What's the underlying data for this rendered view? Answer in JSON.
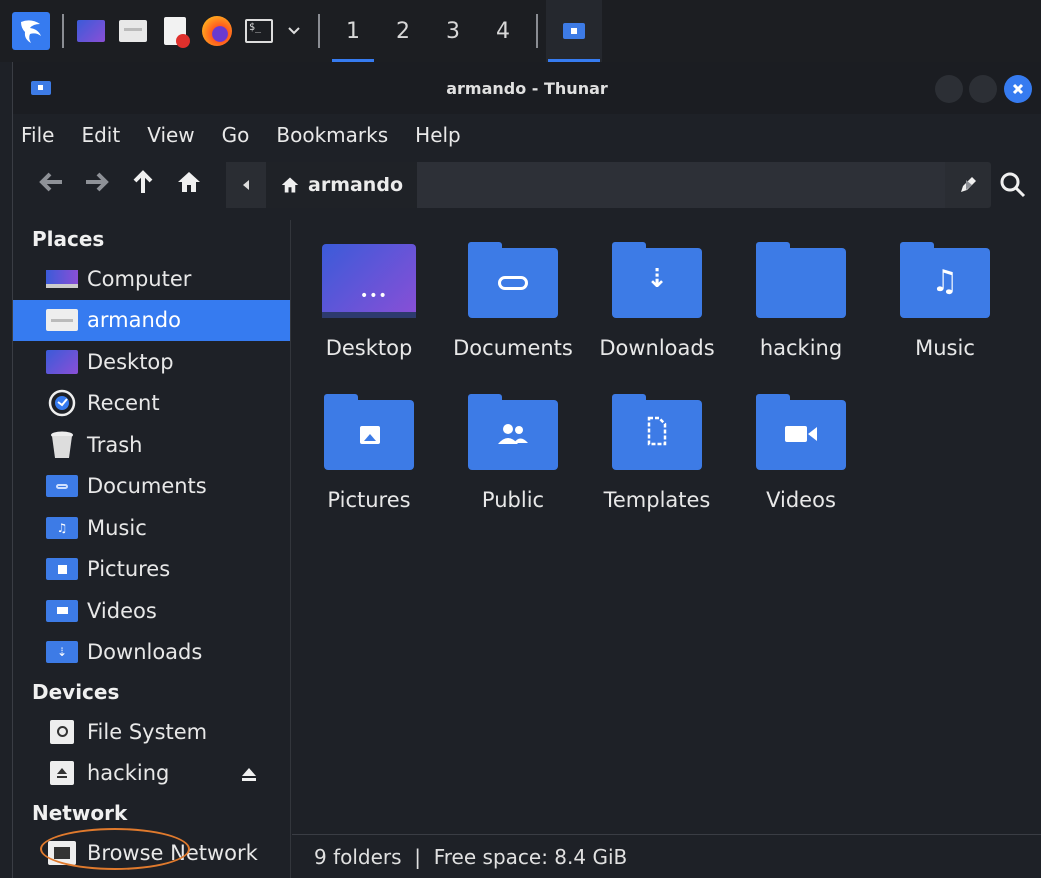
{
  "taskbar": {
    "workspaces": [
      "1",
      "2",
      "3",
      "4"
    ],
    "active_workspace": "1",
    "icons": [
      "kali-dragon-icon",
      "desktop-show-icon",
      "file-manager-icon",
      "text-editor-icon",
      "firefox-icon",
      "terminal-icon",
      "chevron-down-icon"
    ]
  },
  "window": {
    "title": "armando - Thunar"
  },
  "menu": [
    "File",
    "Edit",
    "View",
    "Go",
    "Bookmarks",
    "Help"
  ],
  "path": {
    "current": "armando"
  },
  "sidebar": {
    "places_label": "Places",
    "places": [
      {
        "label": "Computer",
        "icon": "computer-icon"
      },
      {
        "label": "armando",
        "icon": "home-folder-icon",
        "selected": true
      },
      {
        "label": "Desktop",
        "icon": "desktop-icon"
      },
      {
        "label": "Recent",
        "icon": "recent-icon"
      },
      {
        "label": "Trash",
        "icon": "trash-icon"
      },
      {
        "label": "Documents",
        "icon": "documents-folder-icon"
      },
      {
        "label": "Music",
        "icon": "music-folder-icon"
      },
      {
        "label": "Pictures",
        "icon": "pictures-folder-icon"
      },
      {
        "label": "Videos",
        "icon": "videos-folder-icon"
      },
      {
        "label": "Downloads",
        "icon": "downloads-folder-icon"
      }
    ],
    "devices_label": "Devices",
    "devices": [
      {
        "label": "File System",
        "icon": "drive-icon"
      },
      {
        "label": "hacking",
        "icon": "removable-drive-icon",
        "eject": true
      }
    ],
    "network_label": "Network",
    "network": [
      {
        "label": "Browse Network",
        "icon": "network-icon"
      }
    ]
  },
  "files": [
    {
      "label": "Desktop",
      "icon": "desktop-folder-icon"
    },
    {
      "label": "Documents",
      "icon": "documents-folder-icon"
    },
    {
      "label": "Downloads",
      "icon": "downloads-folder-icon"
    },
    {
      "label": "hacking",
      "icon": "folder-icon"
    },
    {
      "label": "Music",
      "icon": "music-folder-icon"
    },
    {
      "label": "Pictures",
      "icon": "pictures-folder-icon"
    },
    {
      "label": "Public",
      "icon": "public-folder-icon"
    },
    {
      "label": "Templates",
      "icon": "templates-folder-icon"
    },
    {
      "label": "Videos",
      "icon": "videos-folder-icon"
    }
  ],
  "status": "9 folders  |  Free space: 8.4 GiB",
  "colors": {
    "accent": "#367bf0",
    "folder": "#3d7be6",
    "highlight_ring": "#e07a2d"
  }
}
